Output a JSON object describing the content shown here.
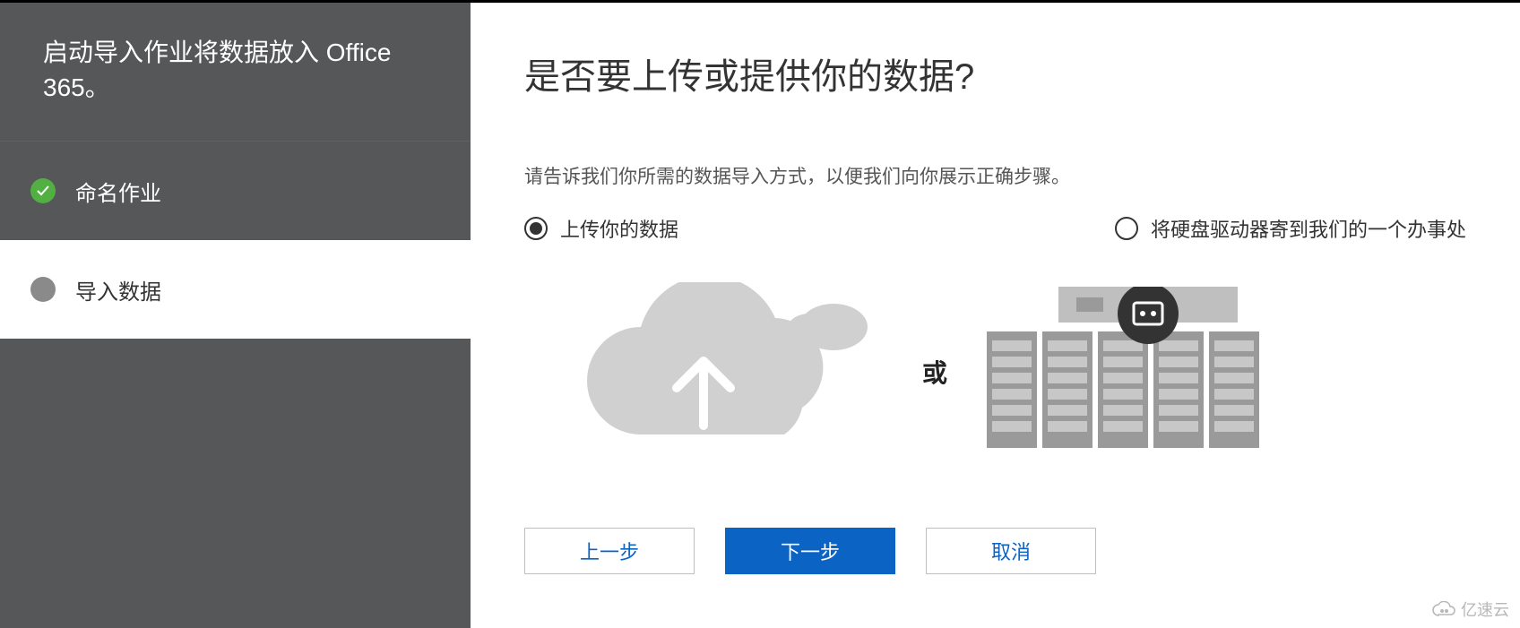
{
  "sidebar": {
    "title": "启动导入作业将数据放入 Office 365。",
    "steps": [
      {
        "label": "命名作业",
        "state": "done"
      },
      {
        "label": "导入数据",
        "state": "active"
      }
    ]
  },
  "main": {
    "title": "是否要上传或提供你的数据?",
    "subtitle": "请告诉我们你所需的数据导入方式，以便我们向你展示正确步骤。",
    "options": {
      "upload": {
        "label": "上传你的数据",
        "selected": true
      },
      "ship": {
        "label": "将硬盘驱动器寄到我们的一个办事处",
        "selected": false
      }
    },
    "or_label": "或"
  },
  "buttons": {
    "prev": "上一步",
    "next": "下一步",
    "cancel": "取消"
  },
  "watermark": "亿速云"
}
